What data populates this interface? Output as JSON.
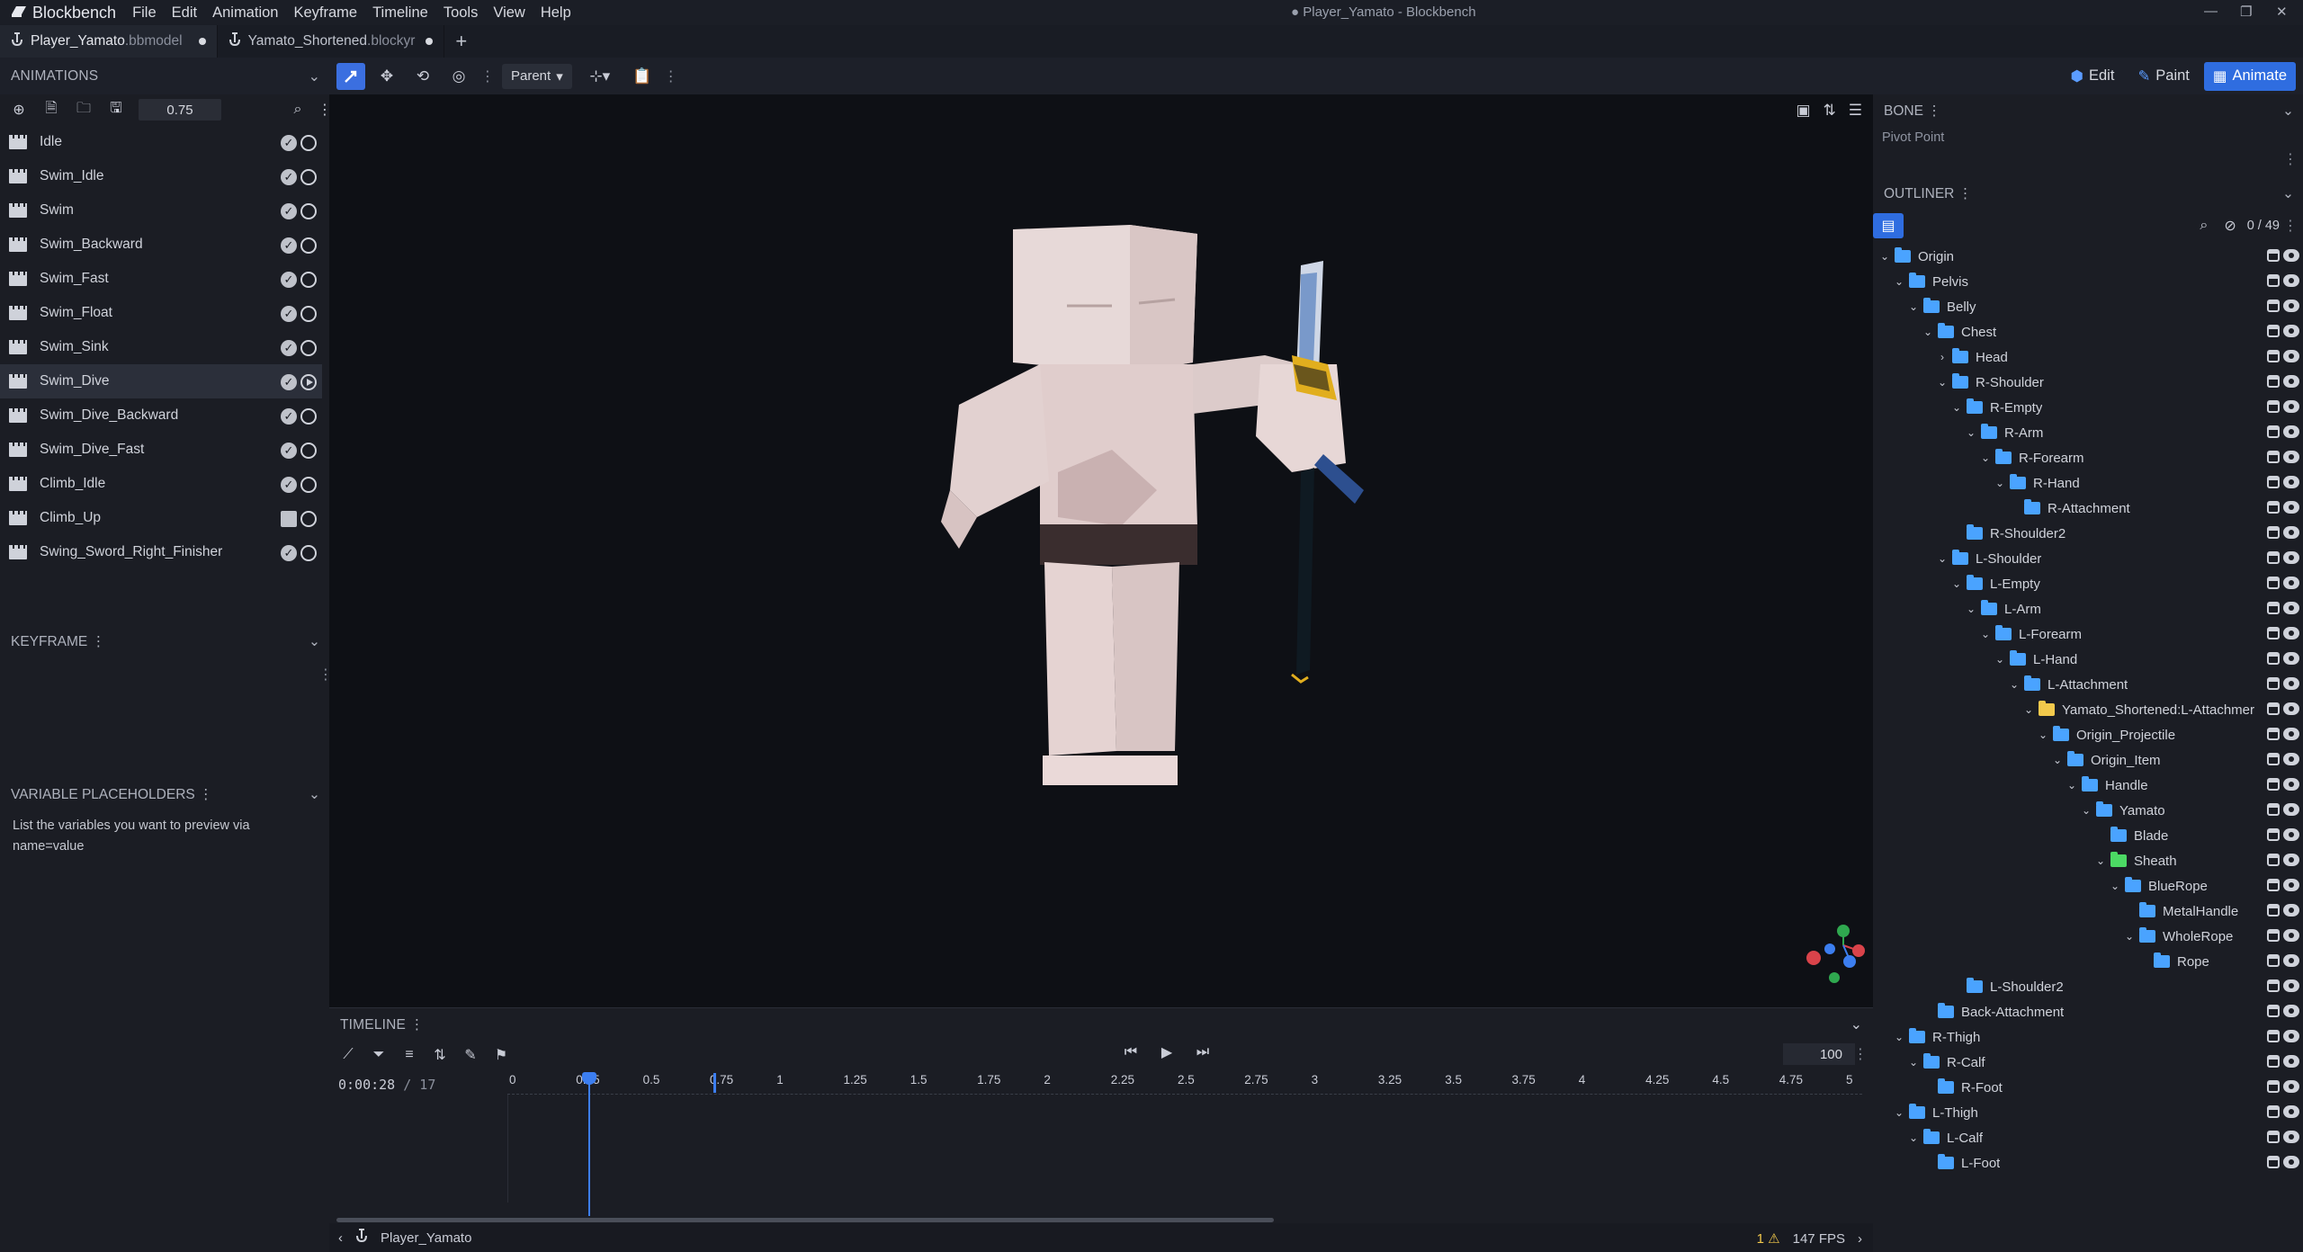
{
  "app": {
    "name": "Blockbench",
    "window_title": "● Player_Yamato - Blockbench"
  },
  "menu": [
    "File",
    "Edit",
    "Animation",
    "Keyframe",
    "Timeline",
    "Tools",
    "View",
    "Help"
  ],
  "tabs": [
    {
      "name": "Player_Yamato",
      "ext": ".bbmodel"
    },
    {
      "name": "Yamato_Shortened",
      "ext": ".blockyr"
    }
  ],
  "toolbar": {
    "transform_space": "Parent"
  },
  "modes": {
    "edit": "Edit",
    "paint": "Paint",
    "animate": "Animate"
  },
  "animations_panel": {
    "title": "ANIMATIONS",
    "snap_value": "0.75",
    "items": [
      {
        "name": "Idle",
        "state": "saved"
      },
      {
        "name": "Swim_Idle",
        "state": "saved"
      },
      {
        "name": "Swim",
        "state": "saved"
      },
      {
        "name": "Swim_Backward",
        "state": "saved"
      },
      {
        "name": "Swim_Fast",
        "state": "saved"
      },
      {
        "name": "Swim_Float",
        "state": "saved"
      },
      {
        "name": "Swim_Sink",
        "state": "saved"
      },
      {
        "name": "Swim_Dive",
        "state": "saved",
        "selected": true
      },
      {
        "name": "Swim_Dive_Backward",
        "state": "saved"
      },
      {
        "name": "Swim_Dive_Fast",
        "state": "saved"
      },
      {
        "name": "Climb_Idle",
        "state": "saved"
      },
      {
        "name": "Climb_Up",
        "state": "unsaved"
      },
      {
        "name": "Swing_Sword_Right_Finisher",
        "state": "saved"
      }
    ]
  },
  "keyframe_panel": {
    "title": "KEYFRAME"
  },
  "variables_panel": {
    "title": "VARIABLE PLACEHOLDERS",
    "hint_line1": "List the variables you want to preview via",
    "hint_line2": "name=value"
  },
  "bone_panel": {
    "title": "BONE",
    "pivot_label": "Pivot Point"
  },
  "outliner": {
    "title": "OUTLINER",
    "count": "0 / 49",
    "nodes": [
      {
        "name": "Origin",
        "depth": 0,
        "open": true
      },
      {
        "name": "Pelvis",
        "depth": 1,
        "open": true
      },
      {
        "name": "Belly",
        "depth": 2,
        "open": true
      },
      {
        "name": "Chest",
        "depth": 3,
        "open": true
      },
      {
        "name": "Head",
        "depth": 4,
        "open": false
      },
      {
        "name": "R-Shoulder",
        "depth": 4,
        "open": true
      },
      {
        "name": "R-Empty",
        "depth": 5,
        "open": true
      },
      {
        "name": "R-Arm",
        "depth": 6,
        "open": true
      },
      {
        "name": "R-Forearm",
        "depth": 7,
        "open": true
      },
      {
        "name": "R-Hand",
        "depth": 8,
        "open": true
      },
      {
        "name": "R-Attachment",
        "depth": 9,
        "open": null
      },
      {
        "name": "R-Shoulder2",
        "depth": 5,
        "open": null
      },
      {
        "name": "L-Shoulder",
        "depth": 4,
        "open": true
      },
      {
        "name": "L-Empty",
        "depth": 5,
        "open": true
      },
      {
        "name": "L-Arm",
        "depth": 6,
        "open": true
      },
      {
        "name": "L-Forearm",
        "depth": 7,
        "open": true
      },
      {
        "name": "L-Hand",
        "depth": 8,
        "open": true
      },
      {
        "name": "L-Attachment",
        "depth": 9,
        "open": true
      },
      {
        "name": "Yamato_Shortened:L-Attachmer",
        "depth": 10,
        "open": true,
        "color": "yellow"
      },
      {
        "name": "Origin_Projectile",
        "depth": 11,
        "open": true
      },
      {
        "name": "Origin_Item",
        "depth": 12,
        "open": true
      },
      {
        "name": "Handle",
        "depth": 13,
        "open": true
      },
      {
        "name": "Yamato",
        "depth": 14,
        "open": true
      },
      {
        "name": "Blade",
        "depth": 15,
        "open": null
      },
      {
        "name": "Sheath",
        "depth": 15,
        "open": true,
        "color": "green"
      },
      {
        "name": "BlueRope",
        "depth": 16,
        "open": true
      },
      {
        "name": "MetalHandle",
        "depth": 17,
        "open": null
      },
      {
        "name": "WholeRope",
        "depth": 17,
        "open": true
      },
      {
        "name": "Rope",
        "depth": 18,
        "open": null
      },
      {
        "name": "L-Shoulder2",
        "depth": 5,
        "open": null
      },
      {
        "name": "Back-Attachment",
        "depth": 3,
        "open": null
      },
      {
        "name": "R-Thigh",
        "depth": 1,
        "open": true
      },
      {
        "name": "R-Calf",
        "depth": 2,
        "open": true
      },
      {
        "name": "R-Foot",
        "depth": 3,
        "open": null
      },
      {
        "name": "L-Thigh",
        "depth": 1,
        "open": true
      },
      {
        "name": "L-Calf",
        "depth": 2,
        "open": true
      },
      {
        "name": "L-Foot",
        "depth": 3,
        "open": null
      }
    ]
  },
  "timeline": {
    "title": "TIMELINE",
    "timecode": "0:00:28",
    "total": "/ 17",
    "fps_setting": "100",
    "ticks": [
      "0",
      "0.25",
      "0.5",
      "0.75",
      "1",
      "1.25",
      "1.5",
      "1.75",
      "2",
      "2.25",
      "2.5",
      "2.75",
      "3",
      "3.25",
      "3.5",
      "3.75",
      "4",
      "4.25",
      "4.5",
      "4.75",
      "5"
    ],
    "playhead_time": 0.28
  },
  "status": {
    "model_name": "Player_Yamato",
    "warnings": "1",
    "fps": "147 FPS"
  },
  "colors": {
    "accent": "#3b6fe0",
    "folder": "#4aa3ff",
    "warning": "#f2c94c"
  }
}
